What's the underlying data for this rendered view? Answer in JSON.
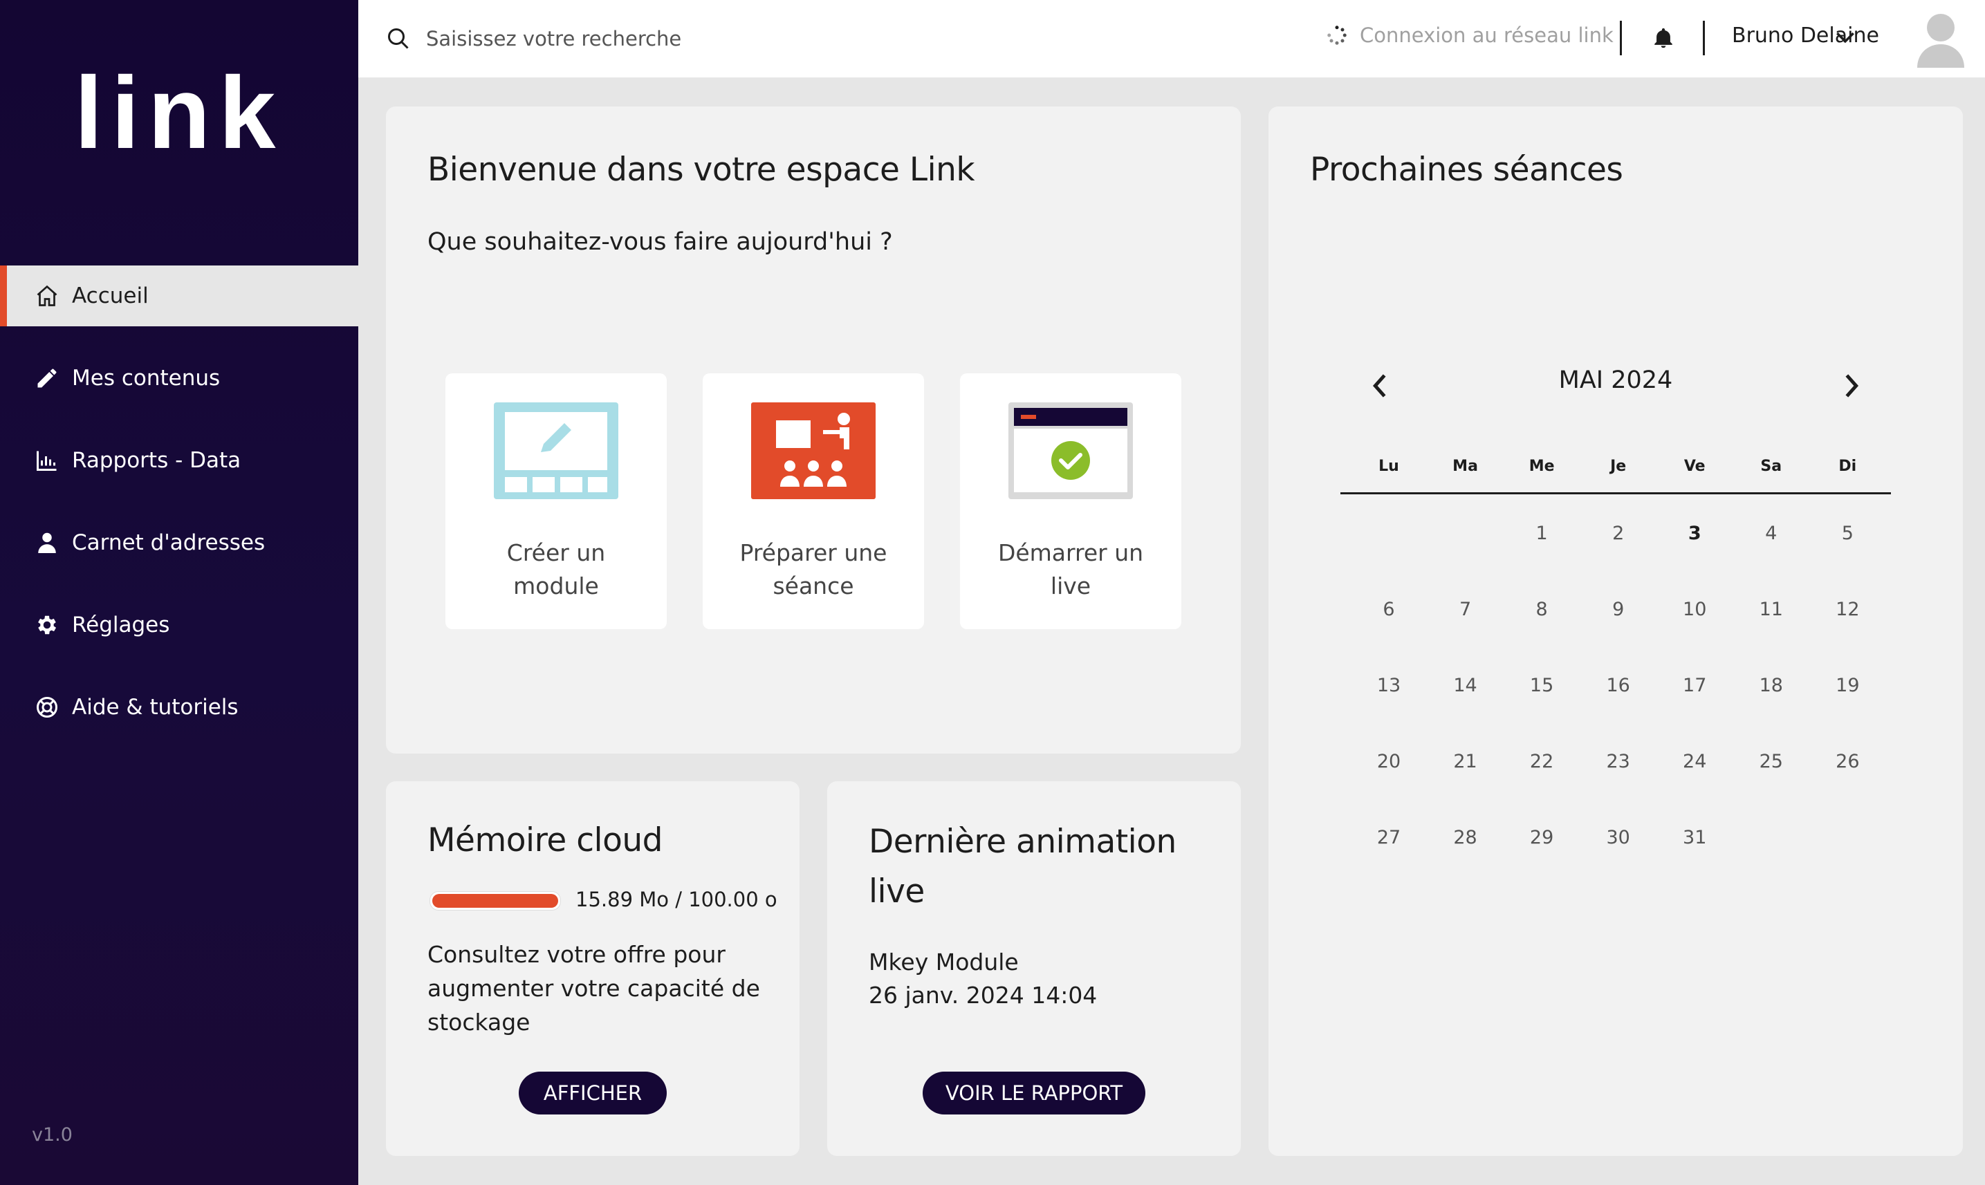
{
  "app": {
    "logo": "link",
    "version": "v1.0"
  },
  "sidebar": {
    "items": [
      {
        "label": "Accueil",
        "icon": "home-icon",
        "active": true
      },
      {
        "label": "Mes contenus",
        "icon": "pencil-icon"
      },
      {
        "label": "Rapports - Data",
        "icon": "chart-icon"
      },
      {
        "label": "Carnet d'adresses",
        "icon": "person-icon"
      },
      {
        "label": "Réglages",
        "icon": "gear-icon"
      },
      {
        "label": "Aide & tutoriels",
        "icon": "lifebuoy-icon"
      }
    ]
  },
  "topbar": {
    "search_placeholder": "Saisissez votre recherche",
    "connection_status": "Connexion au réseau link",
    "user_name": "Bruno Delaine"
  },
  "welcome": {
    "title": "Bienvenue dans votre espace Link",
    "subtitle": "Que souhaitez-vous faire aujourd'hui ?",
    "actions": [
      {
        "line1": "Créer un",
        "line2": "module",
        "icon": "create-module-icon"
      },
      {
        "line1": "Préparer une",
        "line2": "séance",
        "icon": "prepare-session-icon"
      },
      {
        "line1": "Démarrer un",
        "line2": "live",
        "icon": "start-live-icon"
      }
    ]
  },
  "sessions": {
    "title": "Prochaines séances",
    "month": "MAI 2024",
    "weekdays": [
      "Lu",
      "Ma",
      "Me",
      "Je",
      "Ve",
      "Sa",
      "Di"
    ],
    "first_weekday_index": 2,
    "days_in_month": 31,
    "today": 3
  },
  "cloud": {
    "title": "Mémoire cloud",
    "usage_text": "15.89 Mo / 100.00 o",
    "usage_fraction": 1.0,
    "description": "Consultez votre offre pour augmenter votre capacité de stockage",
    "button": "AFFICHER"
  },
  "last_live": {
    "title": "Dernière animation live",
    "module": "Mkey Module",
    "date": "26 janv. 2024 14:04",
    "button": "VOIR LE RAPPORT"
  },
  "colors": {
    "sidebar": "#150735",
    "accent": "#e24b2a",
    "card": "#f2f2f2",
    "background": "#e6e6e6",
    "success": "#8bbd2a",
    "light_blue": "#a8dde6"
  }
}
